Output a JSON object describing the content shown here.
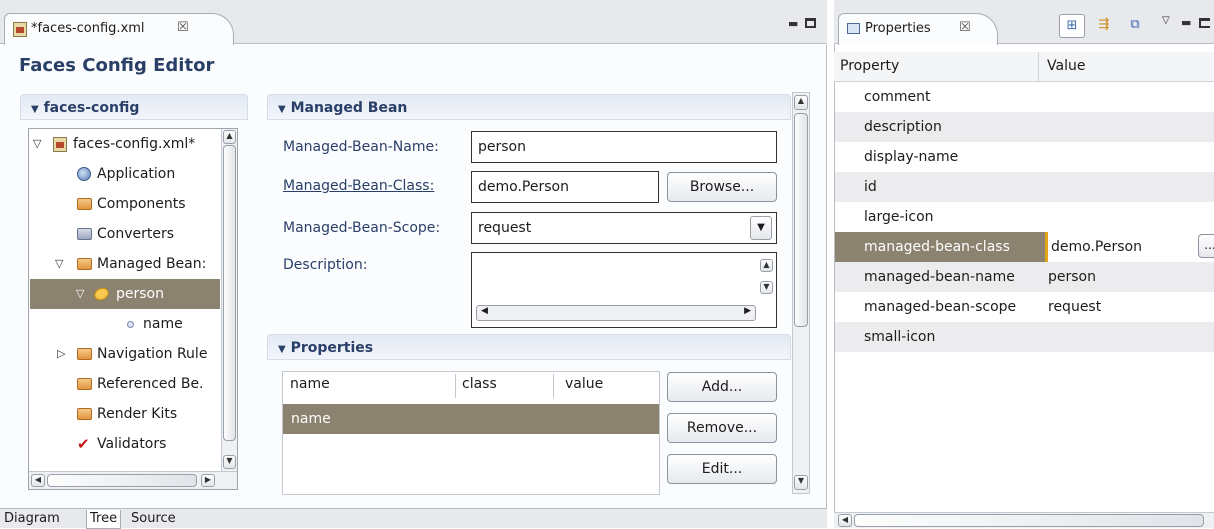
{
  "editor": {
    "tab_title": "*faces-config.xml",
    "tab_close": "☒",
    "title": "Faces Config Editor",
    "tree_section_title": "faces-config",
    "tree": [
      {
        "label": "faces-config.xml*",
        "icon": "faces-config-file-icon",
        "expand": "▽"
      },
      {
        "label": "Application",
        "icon": "application-icon"
      },
      {
        "label": "Components",
        "icon": "components-folder-icon"
      },
      {
        "label": "Converters",
        "icon": "converters-folder-icon"
      },
      {
        "label": "Managed Bean:",
        "icon": "managed-beans-folder-icon",
        "expand": "▽"
      },
      {
        "label": "person",
        "icon": "bean-icon",
        "expand": "▽",
        "selected": true
      },
      {
        "label": "name",
        "icon": "property-dot-icon"
      },
      {
        "label": "Navigation Rule",
        "icon": "navigation-folder-icon",
        "expand": "▷"
      },
      {
        "label": "Referenced Be.",
        "icon": "referenced-beans-folder-icon"
      },
      {
        "label": "Render Kits",
        "icon": "render-kits-folder-icon"
      },
      {
        "label": "Validators",
        "icon": "validators-check-icon"
      }
    ],
    "managed_bean": {
      "section_title": "Managed Bean",
      "name_label": "Managed-Bean-Name:",
      "name_value": "person",
      "class_label": "Managed-Bean-Class:",
      "class_value": "demo.Person",
      "browse_label": "Browse...",
      "browse_mnemonic": "B",
      "scope_label": "Managed-Bean-Scope:",
      "scope_value": "request",
      "description_label": "Description:",
      "description_value": ""
    },
    "properties": {
      "section_title": "Properties",
      "columns": [
        "name",
        "class",
        "value"
      ],
      "rows": [
        {
          "name": "name",
          "class": "",
          "value": ""
        }
      ],
      "add_label": "Add...",
      "remove_label": "Remove...",
      "edit_label": "Edit..."
    },
    "bottom_tabs": [
      "Diagram",
      "Tree",
      "Source"
    ],
    "active_bottom_tab": "Tree"
  },
  "properties_view": {
    "tab_title": "Properties",
    "tab_close": "☒",
    "columns": {
      "property": "Property",
      "value": "Value"
    },
    "rows": [
      {
        "name": "comment",
        "value": ""
      },
      {
        "name": "description",
        "value": ""
      },
      {
        "name": "display-name",
        "value": ""
      },
      {
        "name": "id",
        "value": ""
      },
      {
        "name": "large-icon",
        "value": ""
      },
      {
        "name": "managed-bean-class",
        "value": "demo.Person",
        "selected": true,
        "button": "..."
      },
      {
        "name": "managed-bean-name",
        "value": "person"
      },
      {
        "name": "managed-bean-scope",
        "value": "request"
      },
      {
        "name": "small-icon",
        "value": ""
      }
    ]
  },
  "colors": {
    "selection": "#8c8270",
    "heading": "#2a3f68",
    "chrome": "#e7e9ec"
  }
}
